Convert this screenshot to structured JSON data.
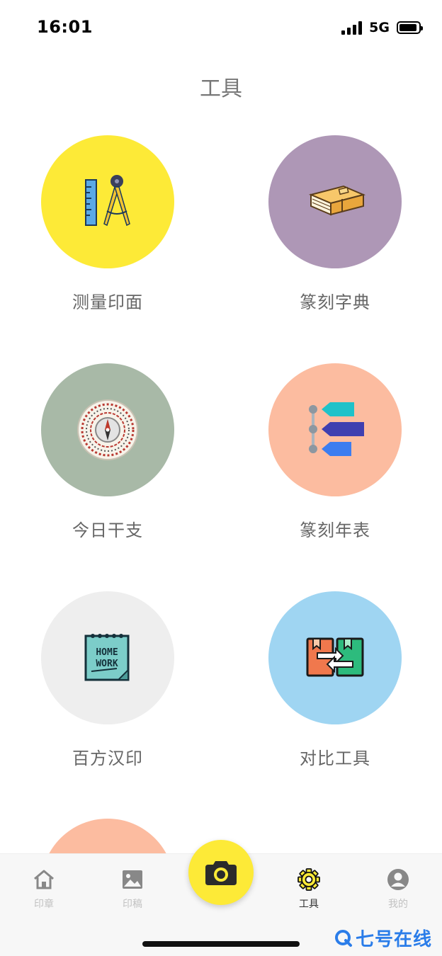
{
  "status_bar": {
    "time": "16:01",
    "network": "5G"
  },
  "header": {
    "title": "工具"
  },
  "tools": [
    {
      "label": "测量印面",
      "icon": "ruler-compass-icon",
      "color": "#fdea37"
    },
    {
      "label": "篆刻字典",
      "icon": "book-stack-icon",
      "color": "#ae97b6"
    },
    {
      "label": "今日干支",
      "icon": "feng-shui-compass-icon",
      "color": "#a8b9a7"
    },
    {
      "label": "篆刻年表",
      "icon": "timeline-arrows-icon",
      "color": "#fcbca0"
    },
    {
      "label": "百方汉印",
      "icon": "homework-notebook-icon",
      "color": "#eeeeee"
    },
    {
      "label": "对比工具",
      "icon": "compare-books-icon",
      "color": "#9fd5f2"
    }
  ],
  "notebook_text": {
    "line1": "HOME",
    "line2": "WORK"
  },
  "tabbar": {
    "items": [
      {
        "label": "印章",
        "icon": "home-icon",
        "active": false
      },
      {
        "label": "印稿",
        "icon": "image-icon",
        "active": false
      },
      {
        "label": "工具",
        "icon": "gear-icon",
        "active": true
      },
      {
        "label": "我的",
        "icon": "user-icon",
        "active": false
      }
    ],
    "camera_icon": "camera-icon",
    "accent": "#fdea37"
  },
  "watermark": {
    "text": "七号在线",
    "icon": "q-logo-icon",
    "color": "#2b7de9"
  }
}
